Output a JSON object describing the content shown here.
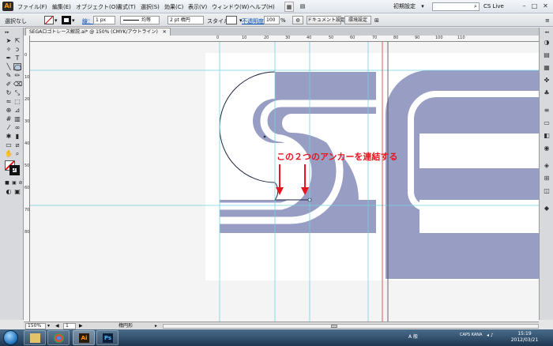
{
  "menubar": {
    "logo": "Ai",
    "items": [
      "ファイル(F)",
      "編集(E)",
      "オブジェクト(O)",
      "書式(T)",
      "選択(S)",
      "効果(C)",
      "表示(V)",
      "ウィンドウ(W)",
      "ヘルプ(H)"
    ],
    "workspace": "初期設定",
    "cslive": "CS Live"
  },
  "controlbar": {
    "selection_label": "選択なし",
    "stroke_label": "線：",
    "stroke_weight": "1 px",
    "stroke_style": "均等",
    "brush": "2 pt 楕円",
    "style_label": "スタイル：",
    "opacity_label": "不透明度：",
    "opacity_value": "100",
    "opacity_unit": "%",
    "doc_settings": "ドキュメント設定",
    "preferences": "環境設定"
  },
  "document": {
    "tab_title": "SEGAロゴトレース解説.ai* @ 150% (CMYK/アウトライン)"
  },
  "rulers": {
    "top": [
      "0",
      "10",
      "20",
      "30",
      "40",
      "50",
      "60",
      "70",
      "80",
      "90",
      "100",
      "110"
    ],
    "left": [
      "0",
      "10",
      "20",
      "30",
      "40",
      "50",
      "60",
      "70",
      "80"
    ]
  },
  "annotation": {
    "text": "この２つのアンカーを連結する",
    "color": "#e8141e"
  },
  "colors": {
    "logo_fill": "#989dc4",
    "guide": "#6fd4e3",
    "red_guide": "#d83030"
  },
  "statusbar": {
    "zoom": "150%",
    "page": "1",
    "tool": "楕円形"
  },
  "taskbar": {
    "apps": [
      "chrome-icon",
      "illustrator-icon",
      "photoshop-icon"
    ],
    "ime": "A 般",
    "caps": "CAPS KANA",
    "time": "15:19",
    "date": "2012/03/21"
  }
}
